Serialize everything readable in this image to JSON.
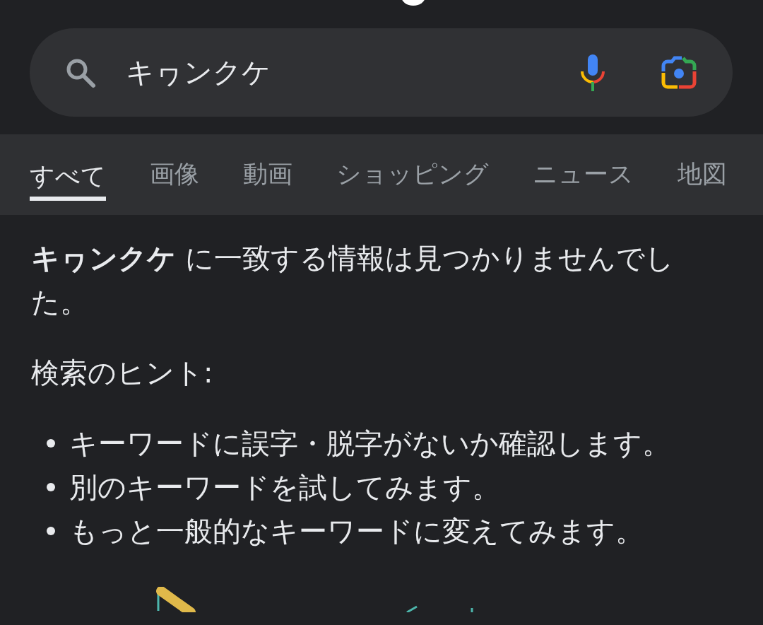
{
  "search": {
    "value": "キヮンクケ"
  },
  "tabs": [
    {
      "label": "すべて",
      "selected": true
    },
    {
      "label": "画像",
      "selected": false
    },
    {
      "label": "動画",
      "selected": false
    },
    {
      "label": "ショッピング",
      "selected": false
    },
    {
      "label": "ニュース",
      "selected": false
    },
    {
      "label": "地図",
      "selected": false
    }
  ],
  "message": "**キヮンクケ** に一致する情報は見つかりませんでした。",
  "hints": {
    "title": "検索のヒント:",
    "items": [
      "キーワードに誤字・脱字がないか確認します。",
      "別のキーワードを試してみます。",
      "もっと一般的なキーワードに変えてみます。"
    ]
  }
}
